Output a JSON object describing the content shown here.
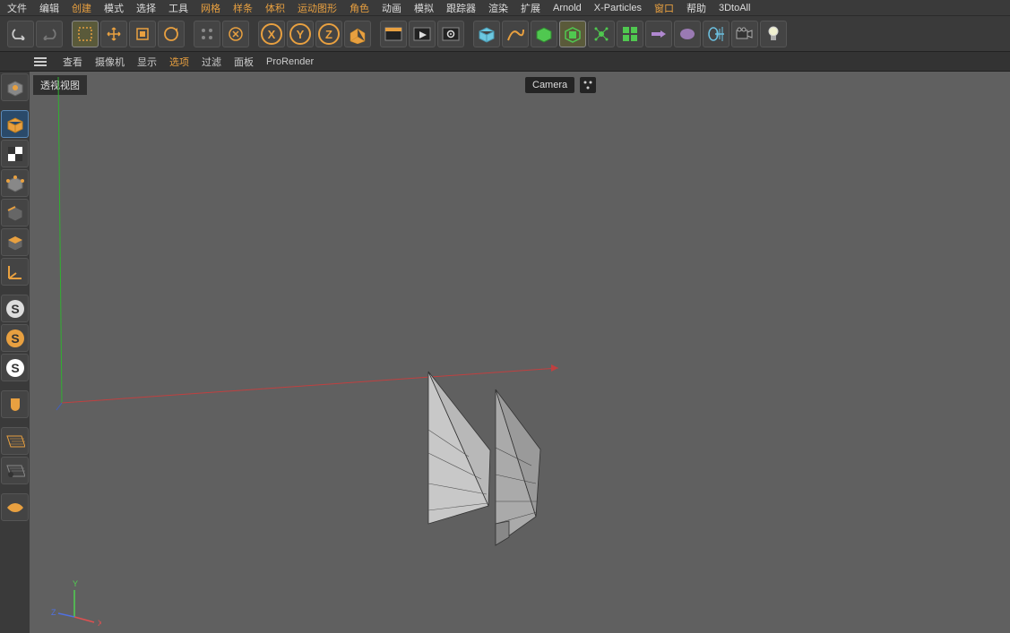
{
  "menu": {
    "items": [
      {
        "label": "文件",
        "orange": false
      },
      {
        "label": "编辑",
        "orange": false
      },
      {
        "label": "创建",
        "orange": true
      },
      {
        "label": "模式",
        "orange": false
      },
      {
        "label": "选择",
        "orange": false
      },
      {
        "label": "工具",
        "orange": false
      },
      {
        "label": "网格",
        "orange": true
      },
      {
        "label": "样条",
        "orange": true
      },
      {
        "label": "体积",
        "orange": true
      },
      {
        "label": "运动图形",
        "orange": true
      },
      {
        "label": "角色",
        "orange": true
      },
      {
        "label": "动画",
        "orange": false
      },
      {
        "label": "模拟",
        "orange": false
      },
      {
        "label": "跟踪器",
        "orange": false
      },
      {
        "label": "渲染",
        "orange": false
      },
      {
        "label": "扩展",
        "orange": false
      },
      {
        "label": "Arnold",
        "orange": false
      },
      {
        "label": "X-Particles",
        "orange": false
      },
      {
        "label": "窗口",
        "orange": true
      },
      {
        "label": "帮助",
        "orange": false
      },
      {
        "label": "3DtoAll",
        "orange": false
      }
    ]
  },
  "viewportBar": {
    "items": [
      {
        "label": "查看",
        "orange": false
      },
      {
        "label": "摄像机",
        "orange": false
      },
      {
        "label": "显示",
        "orange": false
      },
      {
        "label": "选项",
        "orange": true
      },
      {
        "label": "过滤",
        "orange": false
      },
      {
        "label": "面板",
        "orange": false
      },
      {
        "label": "ProRender",
        "orange": false
      }
    ]
  },
  "viewport": {
    "label": "透视视图",
    "cameraLabel": "Camera"
  },
  "axisLabels": {
    "x": "X",
    "y": "Y",
    "z": "Z"
  },
  "colors": {
    "accent": "#e8a040",
    "red": "#d04848",
    "green": "#50c850",
    "blue": "#5080d0",
    "bg": "#606060"
  }
}
